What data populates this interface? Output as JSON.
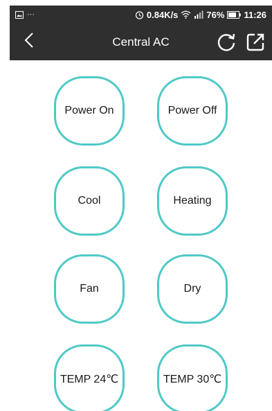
{
  "status_bar": {
    "speed": "0.84K/s",
    "battery": "76%",
    "time": "11:26",
    "notif_dots": "···"
  },
  "header": {
    "title": "Central AC"
  },
  "buttons": [
    {
      "label": "Power On"
    },
    {
      "label": "Power Off"
    },
    {
      "label": "Cool"
    },
    {
      "label": "Heating"
    },
    {
      "label": "Fan"
    },
    {
      "label": "Dry"
    },
    {
      "label": "TEMP 24℃"
    },
    {
      "label": "TEMP 30℃"
    }
  ],
  "colors": {
    "bar": "#2f2f2f",
    "button_border": "#4fc9c6"
  }
}
